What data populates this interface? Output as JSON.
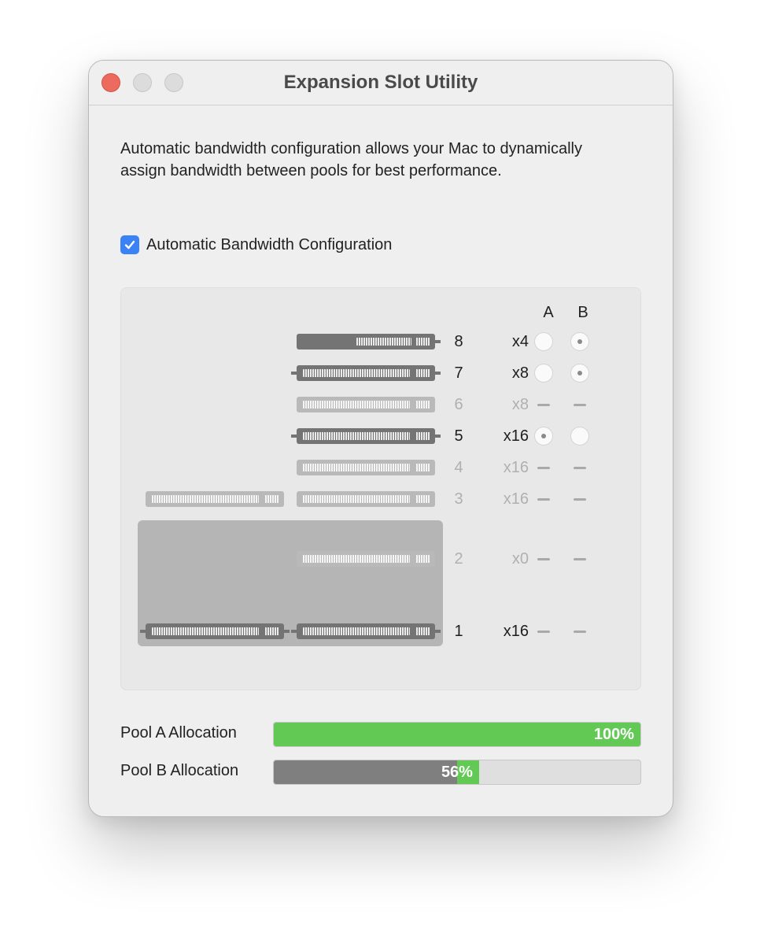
{
  "window": {
    "title": "Expansion Slot Utility"
  },
  "description": "Automatic bandwidth configuration allows your Mac to dynamically assign bandwidth between pools for best performance.",
  "auto_config": {
    "label": "Automatic Bandwidth Configuration",
    "checked": true
  },
  "columns": {
    "a": "A",
    "b": "B"
  },
  "slots": [
    {
      "number": "8",
      "lanes": "x4",
      "active": true,
      "pool_a": "off",
      "pool_b": "on"
    },
    {
      "number": "7",
      "lanes": "x8",
      "active": true,
      "pool_a": "off",
      "pool_b": "on"
    },
    {
      "number": "6",
      "lanes": "x8",
      "active": false,
      "pool_a": "none",
      "pool_b": "none"
    },
    {
      "number": "5",
      "lanes": "x16",
      "active": true,
      "pool_a": "on",
      "pool_b": "off"
    },
    {
      "number": "4",
      "lanes": "x16",
      "active": false,
      "pool_a": "none",
      "pool_b": "none"
    },
    {
      "number": "3",
      "lanes": "x16",
      "active": false,
      "pool_a": "none",
      "pool_b": "none"
    },
    {
      "number": "2",
      "lanes": "x0",
      "active": false,
      "pool_a": "none",
      "pool_b": "none"
    },
    {
      "number": "1",
      "lanes": "x16",
      "active": true,
      "pool_a": "none",
      "pool_b": "none"
    }
  ],
  "pools": [
    {
      "label": "Pool A Allocation",
      "percent_text": "100%",
      "percent": 100,
      "grey_portion": 0
    },
    {
      "label": "Pool B Allocation",
      "percent_text": "56%",
      "percent": 56,
      "grey_portion": 50
    }
  ],
  "colors": {
    "close": "#ec6a5e",
    "checkbox": "#3b82f6",
    "green": "#62c954",
    "active_card": "#747474",
    "inactive_card": "#b9b9b9"
  }
}
